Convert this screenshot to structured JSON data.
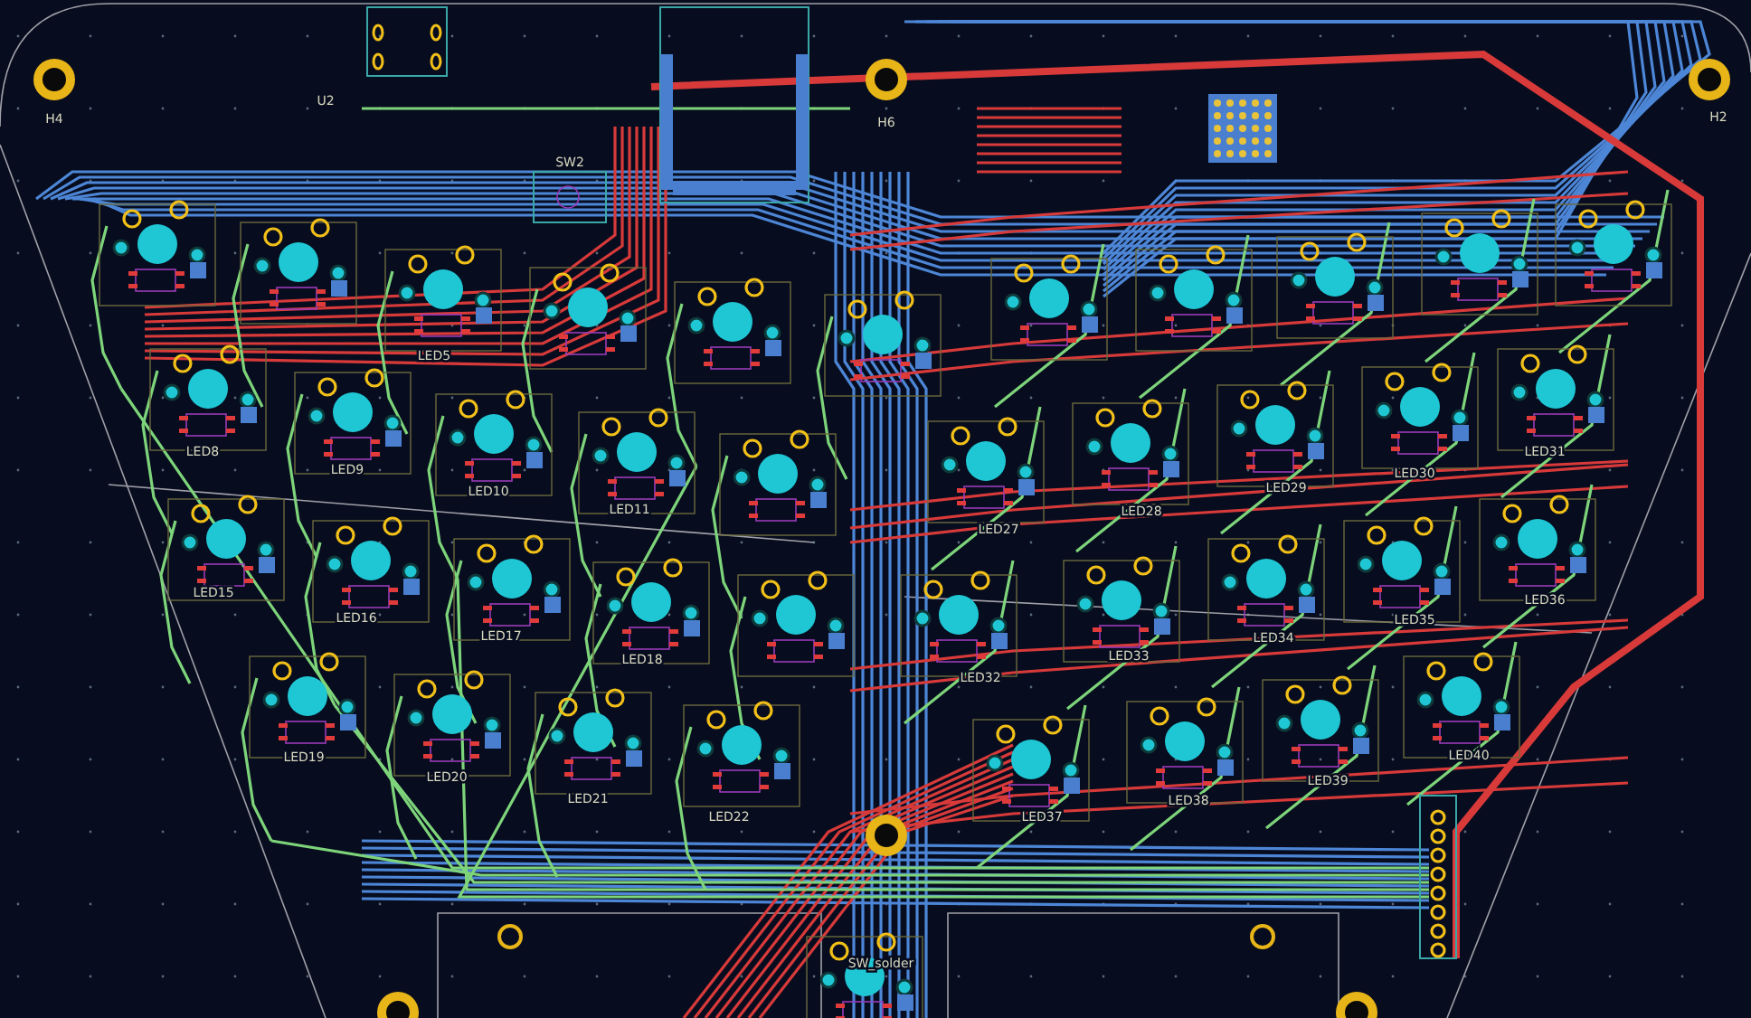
{
  "board": {
    "labels": [
      {
        "text": "H4"
      },
      {
        "text": "H2"
      },
      {
        "text": "H6"
      },
      {
        "text": "SW2"
      },
      {
        "text": "U2"
      },
      {
        "text": "LED5"
      },
      {
        "text": "LED8"
      },
      {
        "text": "LED9"
      },
      {
        "text": "LED10"
      },
      {
        "text": "LED11"
      },
      {
        "text": "LED15"
      },
      {
        "text": "LED16"
      },
      {
        "text": "LED17"
      },
      {
        "text": "LED18"
      },
      {
        "text": "LED19"
      },
      {
        "text": "LED20"
      },
      {
        "text": "LED21"
      },
      {
        "text": "LED22"
      },
      {
        "text": "LED27"
      },
      {
        "text": "LED28"
      },
      {
        "text": "LED29"
      },
      {
        "text": "LED30"
      },
      {
        "text": "LED31"
      },
      {
        "text": "LED32"
      },
      {
        "text": "LED33"
      },
      {
        "text": "LED34"
      },
      {
        "text": "LED35"
      },
      {
        "text": "LED36"
      },
      {
        "text": "LED37"
      },
      {
        "text": "LED38"
      },
      {
        "text": "LED39"
      },
      {
        "text": "LED40"
      },
      {
        "text": "SW_solder"
      }
    ]
  }
}
